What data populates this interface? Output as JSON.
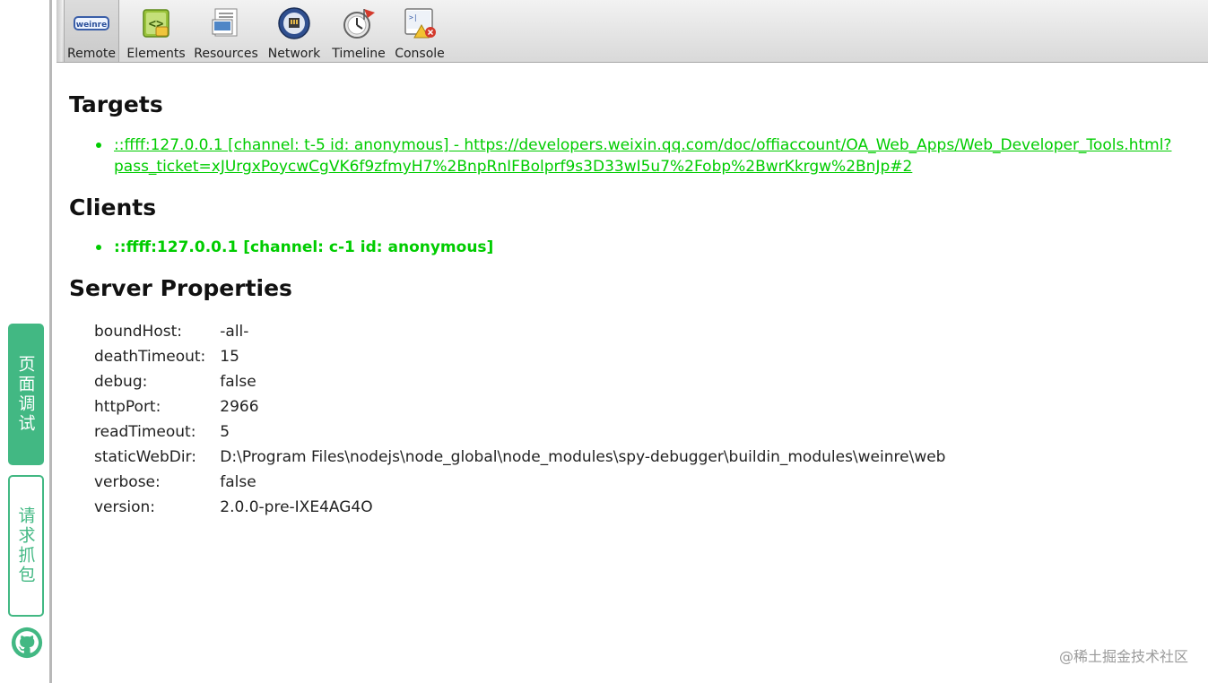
{
  "sidebar": {
    "page_debug_label": "页面调试",
    "request_capture_label": "请求抓包",
    "github_icon": "github-icon",
    "accent_color": "#42b883"
  },
  "toolbar": {
    "tools": [
      {
        "label": "Remote",
        "icon": "weinre-logo-icon",
        "selected": true
      },
      {
        "label": "Elements",
        "icon": "elements-icon"
      },
      {
        "label": "Resources",
        "icon": "resources-icon"
      },
      {
        "label": "Network",
        "icon": "network-icon"
      },
      {
        "label": "Timeline",
        "icon": "timeline-icon"
      },
      {
        "label": "Console",
        "icon": "console-icon"
      }
    ],
    "weinre_logo_text": "weinre"
  },
  "main": {
    "targets_title": "Targets",
    "target_link": "::ffff:127.0.0.1 [channel: t-5 id: anonymous] - https://developers.weixin.qq.com/doc/offiaccount/OA_Web_Apps/Web_Developer_Tools.html?pass_ticket=xJUrgxPoycwCgVK6f9zfmyH7%2BnpRnIFBolprf9s3D33wI5u7%2Fobp%2BwrKkrgw%2BnJp#2",
    "clients_title": "Clients",
    "client_entry": "::ffff:127.0.0.1 [channel: c-1 id: anonymous]",
    "server_properties_title": "Server Properties",
    "server_properties": [
      {
        "key": "boundHost:",
        "value": "-all-"
      },
      {
        "key": "deathTimeout:",
        "value": "15"
      },
      {
        "key": "debug:",
        "value": "false"
      },
      {
        "key": "httpPort:",
        "value": "2966"
      },
      {
        "key": "readTimeout:",
        "value": "5"
      },
      {
        "key": "staticWebDir:",
        "value": "D:\\Program Files\\nodejs\\node_global\\node_modules\\spy-debugger\\buildin_modules\\weinre\\web"
      },
      {
        "key": "verbose:",
        "value": "false"
      },
      {
        "key": "version:",
        "value": "2.0.0-pre-IXE4AG4O"
      }
    ],
    "link_color": "#00cc00"
  },
  "watermark": "@稀土掘金技术社区"
}
